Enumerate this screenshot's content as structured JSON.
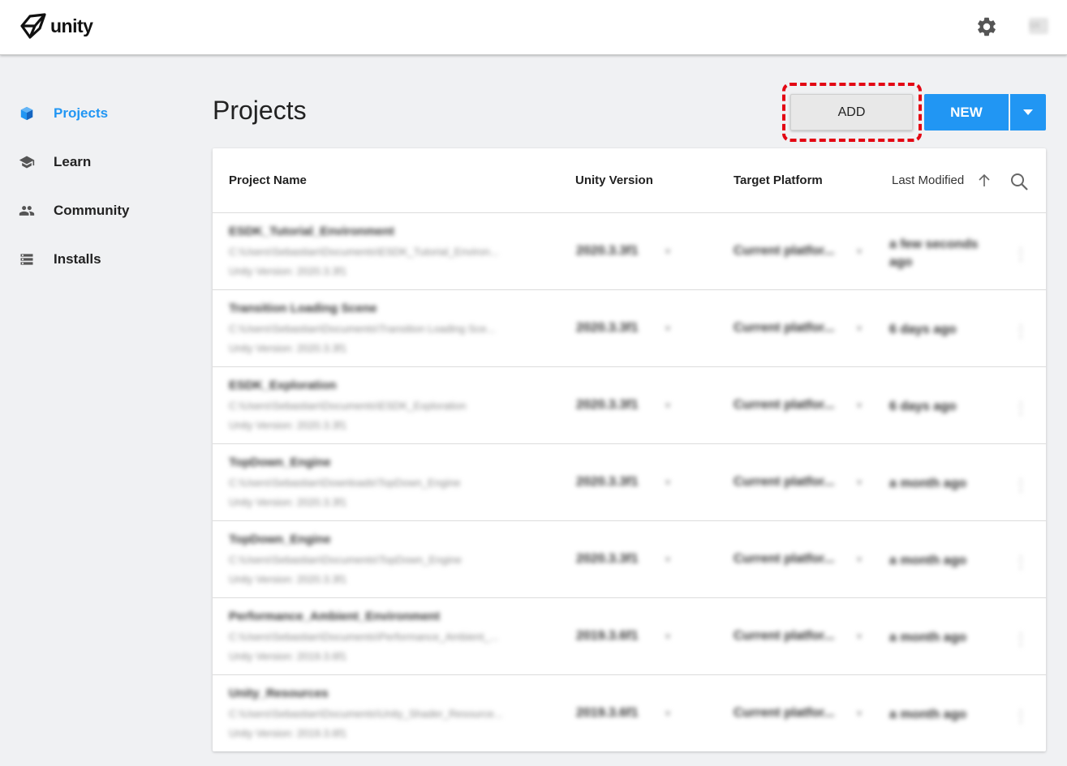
{
  "app": {
    "logo_text": "unity",
    "logo_icon": "unity-cube-logo",
    "settings_icon": "gear-icon",
    "avatar_text": "SR"
  },
  "sidebar": {
    "items": [
      {
        "label": "Projects",
        "icon": "cube-icon",
        "active": true
      },
      {
        "label": "Learn",
        "icon": "graduation-cap-icon",
        "active": false
      },
      {
        "label": "Community",
        "icon": "people-icon",
        "active": false
      },
      {
        "label": "Installs",
        "icon": "list-icon",
        "active": false
      }
    ]
  },
  "main": {
    "title": "Projects",
    "add_label": "ADD",
    "new_label": "NEW",
    "new_dropdown_icon": "caret-down-icon"
  },
  "table": {
    "headers": {
      "name": "Project Name",
      "version": "Unity Version",
      "platform": "Target Platform",
      "modified": "Last Modified"
    },
    "rows": [
      {
        "name": "ESDK_Tutorial_Environment",
        "path": "C:\\Users\\Sebastian\\Documents\\ESDK_Tutorial_Environ...",
        "version_note": "Unity Version: 2020.3.3f1",
        "unity_version": "2020.3.3f1",
        "platform": "Current platfor...",
        "modified": "a few seconds ago"
      },
      {
        "name": "Transition Loading Scene",
        "path": "C:\\Users\\Sebastian\\Documents\\Transition Loading Sce...",
        "version_note": "Unity Version: 2020.3.3f1",
        "unity_version": "2020.3.3f1",
        "platform": "Current platfor...",
        "modified": "6 days ago"
      },
      {
        "name": "ESDK_Exploration",
        "path": "C:\\Users\\Sebastian\\Documents\\ESDK_Exploration",
        "version_note": "Unity Version: 2020.3.3f1",
        "unity_version": "2020.3.3f1",
        "platform": "Current platfor...",
        "modified": "6 days ago"
      },
      {
        "name": "TopDown_Engine",
        "path": "C:\\Users\\Sebastian\\Downloads\\TopDown_Engine",
        "version_note": "Unity Version: 2020.3.3f1",
        "unity_version": "2020.3.3f1",
        "platform": "Current platfor...",
        "modified": "a month ago"
      },
      {
        "name": "TopDown_Engine",
        "path": "C:\\Users\\Sebastian\\Documents\\TopDown_Engine",
        "version_note": "Unity Version: 2020.3.3f1",
        "unity_version": "2020.3.3f1",
        "platform": "Current platfor...",
        "modified": "a month ago"
      },
      {
        "name": "Performance_Ambient_Environment",
        "path": "C:\\Users\\Sebastian\\Documents\\Performance_Ambient_...",
        "version_note": "Unity Version: 2019.3.6f1",
        "unity_version": "2019.3.6f1",
        "platform": "Current platfor...",
        "modified": "a month ago"
      },
      {
        "name": "Unity_Resources",
        "path": "C:\\Users\\Sebastian\\Documents\\Unity_Shader_Resource...",
        "version_note": "Unity Version: 2019.3.6f1",
        "unity_version": "2019.3.6f1",
        "platform": "Current platfor...",
        "modified": "a month ago"
      }
    ]
  },
  "colors": {
    "accent": "#2196f3",
    "highlight": "#e30613"
  }
}
